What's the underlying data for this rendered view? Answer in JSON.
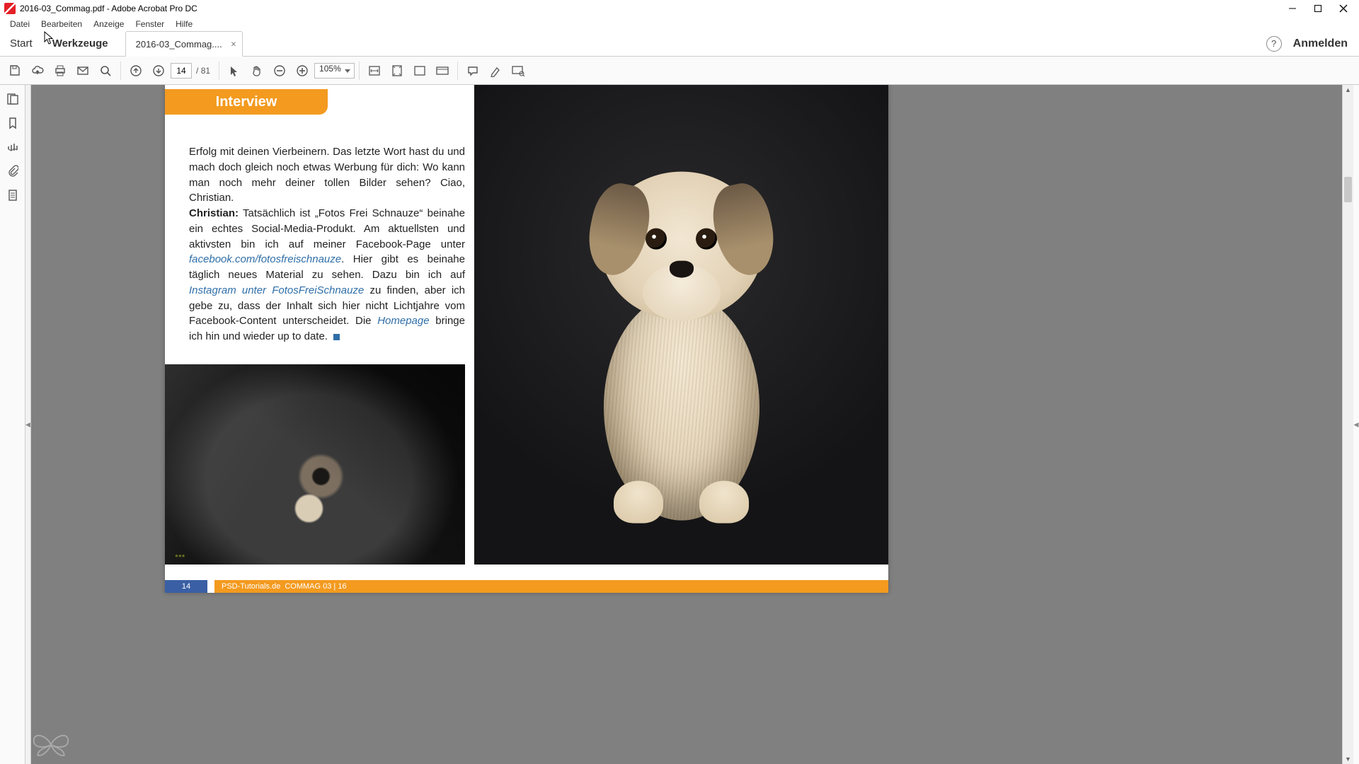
{
  "window": {
    "title": "2016-03_Commag.pdf - Adobe Acrobat Pro DC"
  },
  "menu": {
    "items": [
      "Datei",
      "Bearbeiten",
      "Anzeige",
      "Fenster",
      "Hilfe"
    ]
  },
  "tabs": {
    "start": "Start",
    "tools": "Werkzeuge",
    "doc": "2016-03_Commag....",
    "help_glyph": "?",
    "signin": "Anmelden"
  },
  "toolbar": {
    "page_current": "14",
    "page_sep": "/",
    "page_total": "81",
    "zoom": "105%"
  },
  "article": {
    "banner": "Interview",
    "q_text": "Erfolg mit deinen Vierbeinern. Das letzte Wort hast du und mach doch gleich noch etwas Werbung für dich: Wo kann man noch mehr deiner tollen Bilder sehen? Ciao, Christian.",
    "a_name": "Christian:",
    "a_part1": " Tatsächlich ist „Fotos Frei Schnauze“ beinahe ein echtes Social-Media-Produkt. Am aktuellsten und aktivsten bin ich auf meiner Facebook-Page unter ",
    "link1": "facebook.com/fotosfreischnauze",
    "a_part2": ". Hier gibt es beinahe täglich neues Material zu sehen. Dazu bin ich auf ",
    "link2": "Instagram unter FotosFreiSchnauze",
    "a_part3": " zu finden, aber ich gebe zu, dass der Inhalt sich hier nicht Lichtjahre vom Facebook-Content unterscheidet. Die ",
    "link3": "Homepage",
    "a_part4": " bringe ich hin und wieder up to date. "
  },
  "footer": {
    "page": "14",
    "site": "PSD-Tutorials.de",
    "issue": "COMMAG 03 | 16"
  }
}
